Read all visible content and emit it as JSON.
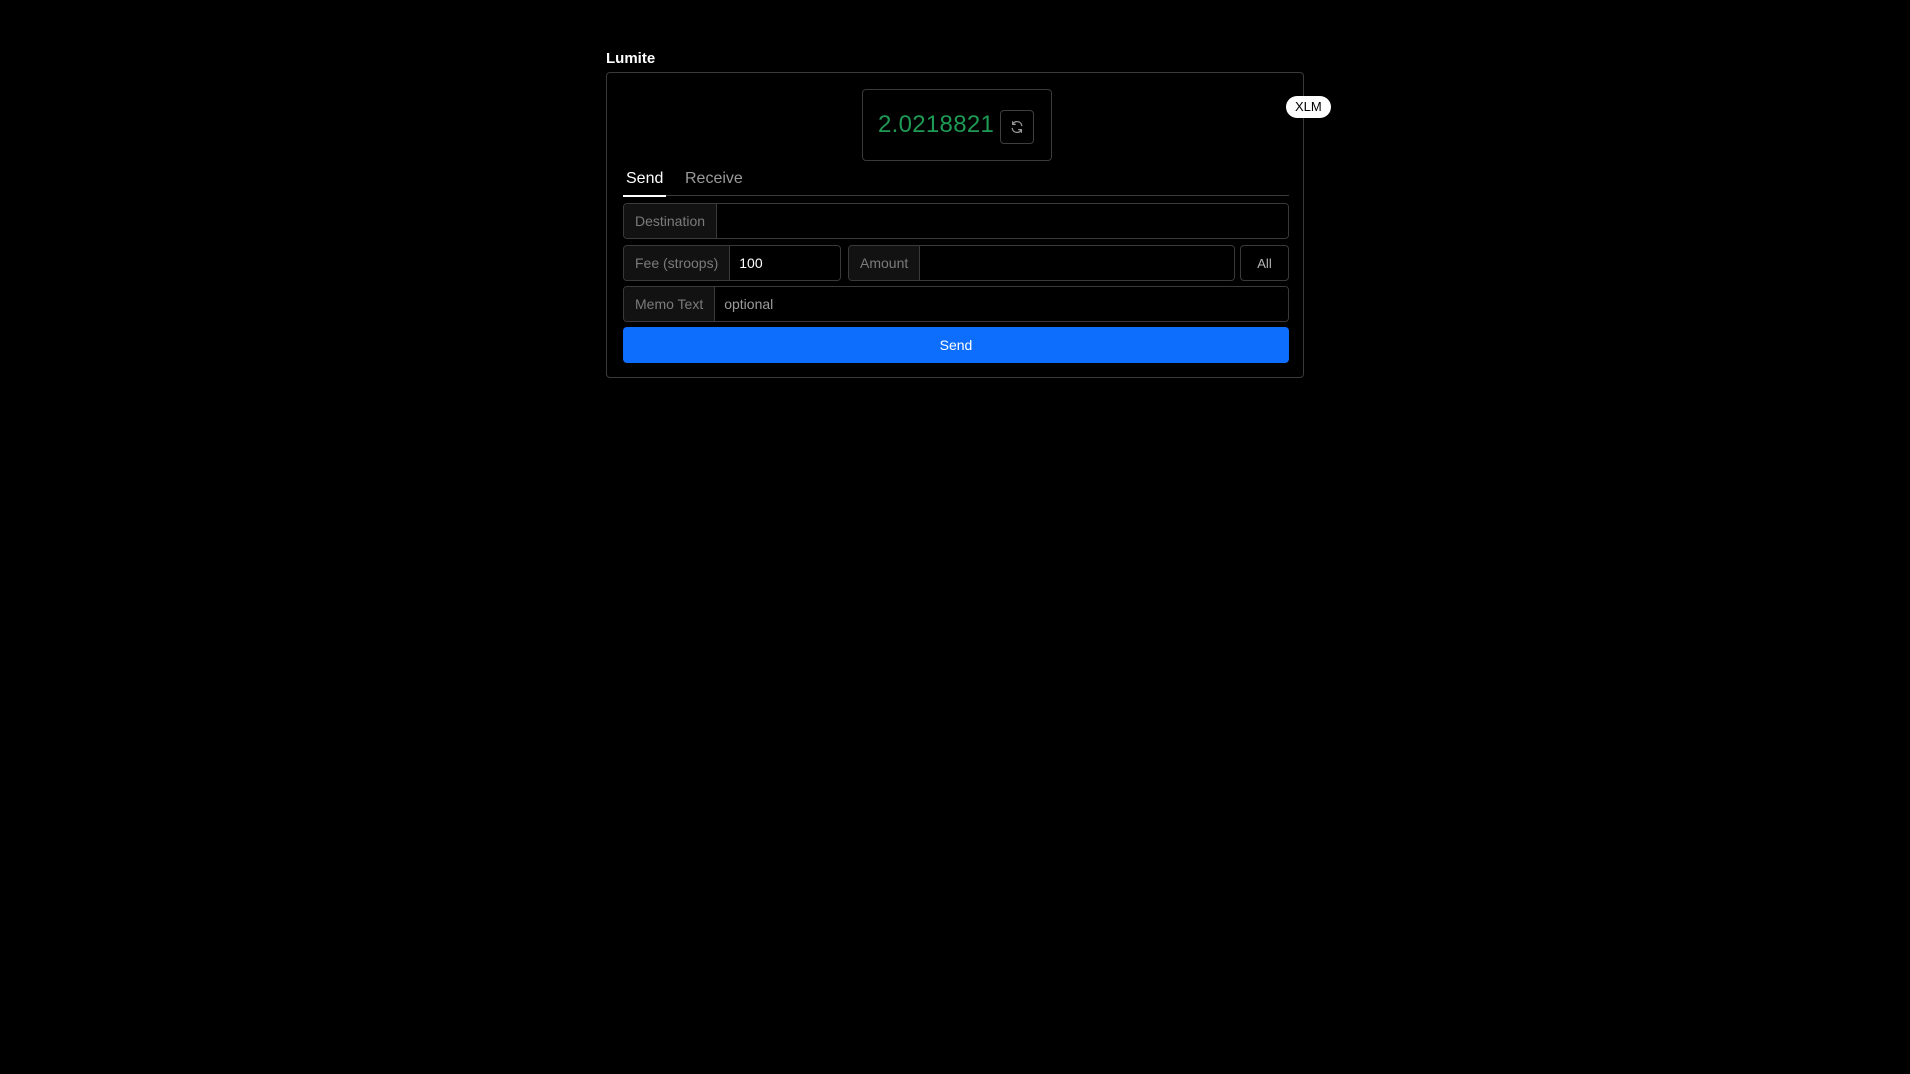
{
  "app": {
    "title": "Lumite"
  },
  "balance": {
    "value": "2.0218821",
    "currency": "XLM",
    "value_color": "#1f9a55",
    "refresh_icon": "refresh-icon"
  },
  "tabs": [
    {
      "label": "Send",
      "active": true
    },
    {
      "label": "Receive",
      "active": false
    }
  ],
  "form": {
    "destination": {
      "label": "Destination",
      "value": "",
      "placeholder": ""
    },
    "fee": {
      "label": "Fee (stroops)",
      "value": "100"
    },
    "amount": {
      "label": "Amount",
      "value": "",
      "placeholder": ""
    },
    "all_label": "All",
    "memo": {
      "label": "Memo Text",
      "value": "",
      "placeholder": "optional"
    },
    "submit_label": "Send"
  },
  "colors": {
    "accent": "#0d6efd",
    "background": "#000000",
    "border": "#3a3a3a"
  }
}
